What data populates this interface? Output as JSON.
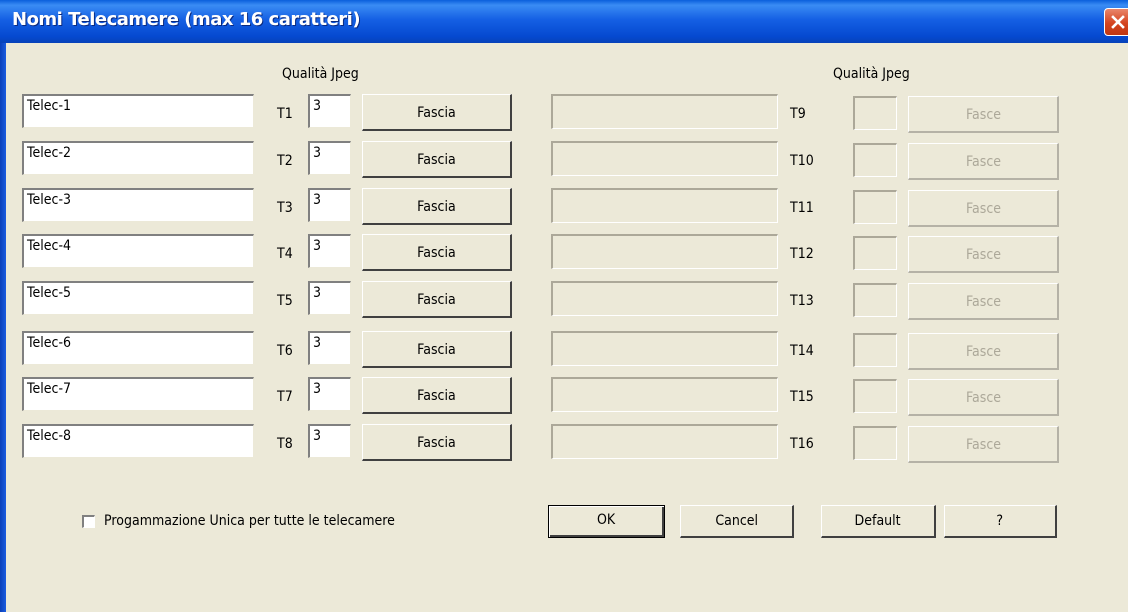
{
  "window": {
    "title": "Nomi Telecamere (max 16 caratteri)"
  },
  "headers": {
    "left_quality": "Qualità Jpeg",
    "right_quality": "Qualità Jpeg"
  },
  "left_rows": [
    {
      "name": "Telec-1",
      "tag": "T1",
      "quality": "3",
      "button": "Fascia"
    },
    {
      "name": "Telec-2",
      "tag": "T2",
      "quality": "3",
      "button": "Fascia"
    },
    {
      "name": "Telec-3",
      "tag": "T3",
      "quality": "3",
      "button": "Fascia"
    },
    {
      "name": "Telec-4",
      "tag": "T4",
      "quality": "3",
      "button": "Fascia"
    },
    {
      "name": "Telec-5",
      "tag": "T5",
      "quality": "3",
      "button": "Fascia"
    },
    {
      "name": "Telec-6",
      "tag": "T6",
      "quality": "3",
      "button": "Fascia"
    },
    {
      "name": "Telec-7",
      "tag": "T7",
      "quality": "3",
      "button": "Fascia"
    },
    {
      "name": "Telec-8",
      "tag": "T8",
      "quality": "3",
      "button": "Fascia"
    }
  ],
  "right_rows": [
    {
      "name": "",
      "tag": "T9",
      "quality": "",
      "button": "Fasce"
    },
    {
      "name": "",
      "tag": "T10",
      "quality": "",
      "button": "Fasce"
    },
    {
      "name": "",
      "tag": "T11",
      "quality": "",
      "button": "Fasce"
    },
    {
      "name": "",
      "tag": "T12",
      "quality": "",
      "button": "Fasce"
    },
    {
      "name": "",
      "tag": "T13",
      "quality": "",
      "button": "Fasce"
    },
    {
      "name": "",
      "tag": "T14",
      "quality": "",
      "button": "Fasce"
    },
    {
      "name": "",
      "tag": "T15",
      "quality": "",
      "button": "Fasce"
    },
    {
      "name": "",
      "tag": "T16",
      "quality": "",
      "button": "Fasce"
    }
  ],
  "options": {
    "single_program_label": "Progammazione Unica per tutte le telecamere",
    "single_program_checked": false
  },
  "buttons": {
    "ok": "OK",
    "cancel": "Cancel",
    "default": "Default",
    "help": "?"
  },
  "icons": {
    "close": "close-icon"
  }
}
